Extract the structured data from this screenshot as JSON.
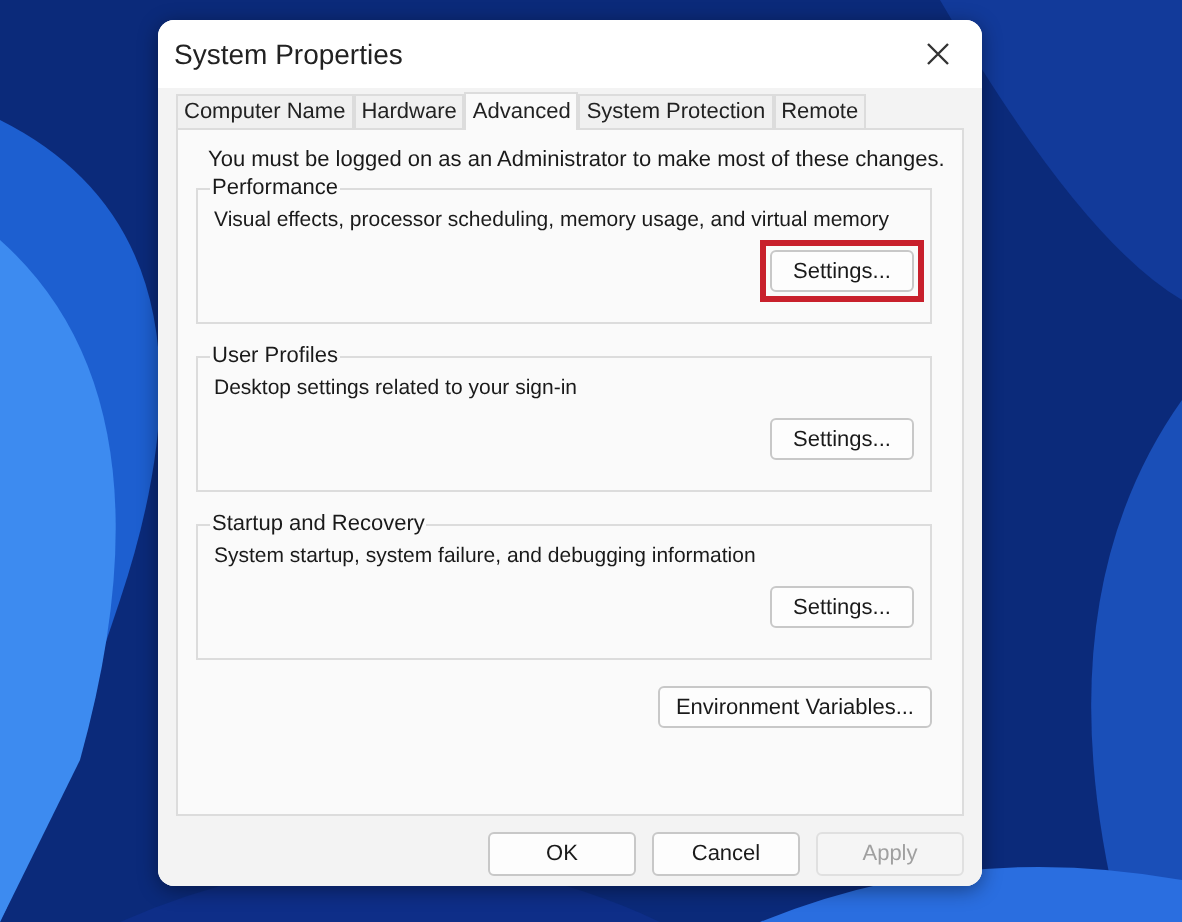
{
  "window": {
    "title": "System Properties"
  },
  "tabs": [
    {
      "label": "Computer Name",
      "selected": false
    },
    {
      "label": "Hardware",
      "selected": false
    },
    {
      "label": "Advanced",
      "selected": true
    },
    {
      "label": "System Protection",
      "selected": false
    },
    {
      "label": "Remote",
      "selected": false
    }
  ],
  "notice": "You must be logged on as an Administrator to make most of these changes.",
  "groups": [
    {
      "title": "Performance",
      "description": "Visual effects, processor scheduling, memory usage, and virtual memory",
      "button": {
        "label": "Settings...",
        "highlighted": true
      }
    },
    {
      "title": "User Profiles",
      "description": "Desktop settings related to your sign-in",
      "button": {
        "label": "Settings...",
        "highlighted": false
      }
    },
    {
      "title": "Startup and Recovery",
      "description": "System startup, system failure, and debugging information",
      "button": {
        "label": "Settings...",
        "highlighted": false
      }
    }
  ],
  "environment_button": {
    "label": "Environment Variables..."
  },
  "buttons": [
    {
      "label": "OK",
      "disabled": false
    },
    {
      "label": "Cancel",
      "disabled": false
    },
    {
      "label": "Apply",
      "disabled": true
    }
  ]
}
